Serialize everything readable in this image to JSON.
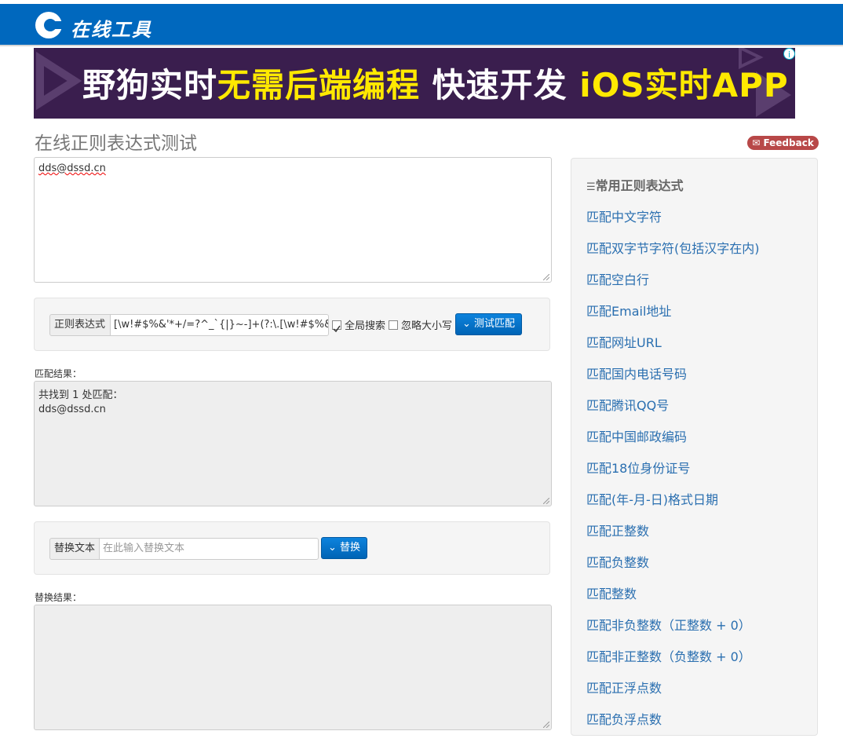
{
  "header": {
    "logo_text": "在线工具"
  },
  "banner": {
    "text_part1": "野狗实时",
    "text_part2": "无需后端编程",
    "text_part3": "快速开发",
    "text_part4": "iOS实时APP",
    "info": "i"
  },
  "page": {
    "title": "在线正则表达式测试",
    "feedback_label": "Feedback"
  },
  "source_text": "dds@dssd.cn",
  "regex": {
    "label": "正则表达式",
    "value": "[\\w!#$%&'*+/=?^_`{|}~-]+(?:\\.[\\w!#$%&'*+/=?^_`",
    "global_label": "全局搜索",
    "global_checked": true,
    "ignorecase_label": "忽略大小写",
    "ignorecase_checked": false,
    "test_button": "测试匹配"
  },
  "match": {
    "label": "匹配结果：",
    "line1": "共找到 1 处匹配：",
    "line2": "dds@dssd.cn"
  },
  "replace": {
    "label": "替换文本",
    "placeholder": "在此输入替换文本",
    "button": "替换",
    "result_label": "替换结果："
  },
  "sidebar": {
    "title": "常用正则表达式",
    "items": [
      "匹配中文字符",
      "匹配双字节字符(包括汉字在内)",
      "匹配空白行",
      "匹配Email地址",
      "匹配网址URL",
      "匹配国内电话号码",
      "匹配腾讯QQ号",
      "匹配中国邮政编码",
      "匹配18位身份证号",
      "匹配(年-月-日)格式日期",
      "匹配正整数",
      "匹配负整数",
      "匹配整数",
      "匹配非负整数（正整数 + 0）",
      "匹配非正整数（负整数 + 0）",
      "匹配正浮点数",
      "匹配负浮点数"
    ]
  },
  "colors": {
    "header_bg": "#0068be",
    "link": "#2a6fb0",
    "button": "#0070c8",
    "feedback": "#b84848"
  }
}
